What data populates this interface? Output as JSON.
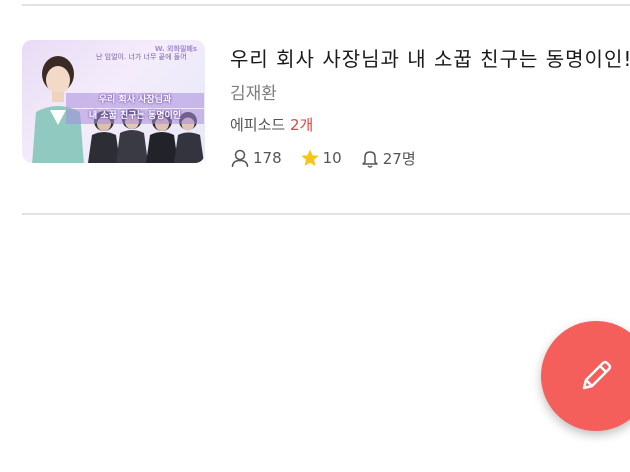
{
  "card": {
    "thumbnail": {
      "badge": "W. 외화밀폐s",
      "tagline": "난 임얼이. 너가 너무 끝에 들어",
      "title_line1": "우리 회사 사장님과",
      "title_line2": "내 소꿉 친구는 동명이인"
    },
    "title": "우리 회사 사장님과 내 소꿉 친구는 동명이인!",
    "author": "김재환",
    "episodes_label": "에피소드",
    "episodes_count": "2개",
    "stats": {
      "readers": "178",
      "stars": "10",
      "subscribers": "27명"
    }
  },
  "colors": {
    "accent": "#f45f5c",
    "episode_count": "#e64545",
    "star": "#f5c518",
    "divider": "#dfe3e4"
  },
  "icons": {
    "readers": "person-icon",
    "stars": "star-icon",
    "subscribers": "bell-icon",
    "fab": "pencil-icon"
  }
}
